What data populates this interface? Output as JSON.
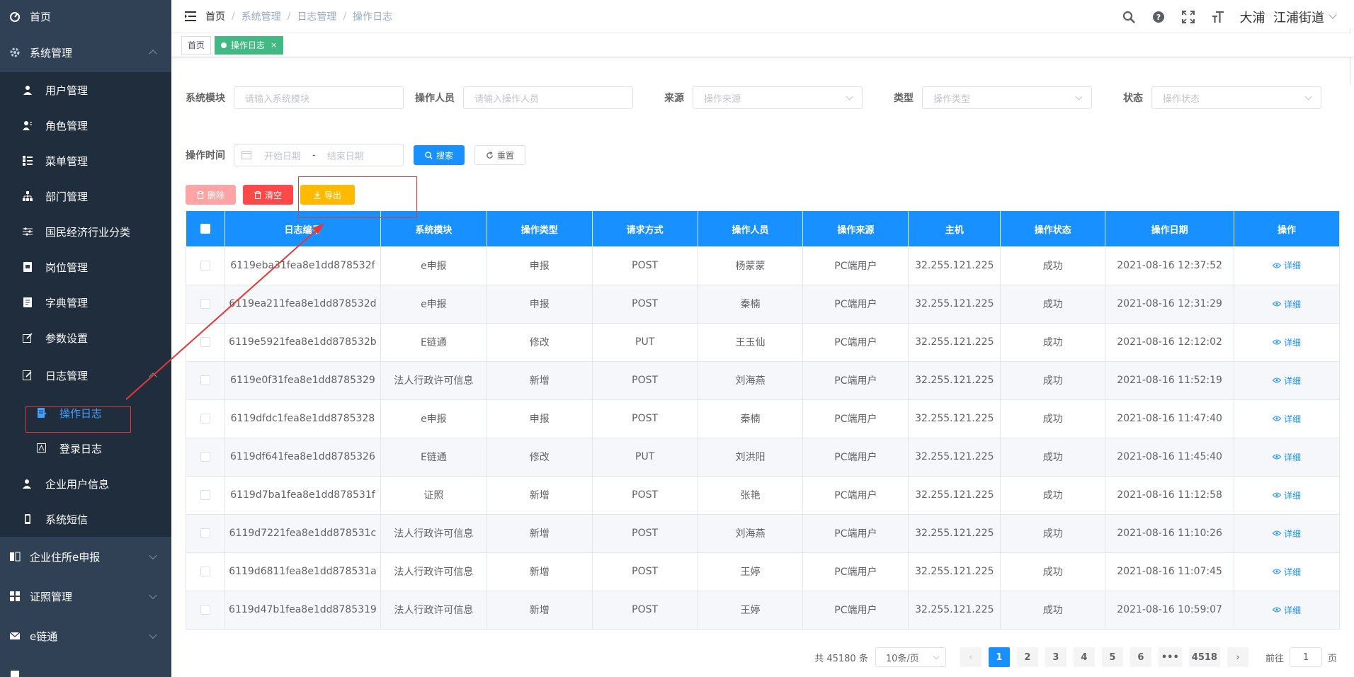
{
  "sidebar": {
    "items": [
      {
        "label": "首页",
        "icon": "dashboard-icon"
      },
      {
        "label": "系统管理",
        "icon": "gear-icon",
        "expanded": true
      },
      {
        "label": "企业住所e申报",
        "icon": "book-icon"
      },
      {
        "label": "证照管理",
        "icon": "grid-icon"
      },
      {
        "label": "e链通",
        "icon": "mail-icon"
      },
      {
        "label": "...",
        "icon": "doc-icon"
      }
    ],
    "system": [
      {
        "label": "用户管理"
      },
      {
        "label": "角色管理"
      },
      {
        "label": "菜单管理"
      },
      {
        "label": "部门管理"
      },
      {
        "label": "国民经济行业分类"
      },
      {
        "label": "岗位管理"
      },
      {
        "label": "字典管理"
      },
      {
        "label": "参数设置"
      },
      {
        "label": "日志管理"
      },
      {
        "label": "企业用户信息"
      },
      {
        "label": "系统短信"
      }
    ],
    "log": [
      {
        "label": "操作日志",
        "active": true
      },
      {
        "label": "登录日志"
      }
    ]
  },
  "navbar": {
    "breadcrumb": [
      "首页",
      "系统管理",
      "日志管理",
      "操作日志"
    ],
    "user": "大浦",
    "area": "江浦街道"
  },
  "tags": {
    "home": "首页",
    "current": "操作日志",
    "close": "×"
  },
  "filters": {
    "module_label": "系统模块",
    "module_placeholder": "请输入系统模块",
    "operator_label": "操作人员",
    "operator_placeholder": "请输入操作人员",
    "source_label": "来源",
    "source_placeholder": "操作来源",
    "type_label": "类型",
    "type_placeholder": "操作类型",
    "status_label": "状态",
    "status_placeholder": "操作状态",
    "time_label": "操作时间",
    "start_placeholder": "开始日期",
    "range_sep": "-",
    "end_placeholder": "结束日期",
    "search": "搜索",
    "reset": "重置"
  },
  "toolbar": {
    "delete": "删除",
    "clear": "清空",
    "export": "导出"
  },
  "table": {
    "headers": [
      "日志编号",
      "系统模块",
      "操作类型",
      "请求方式",
      "操作人员",
      "操作来源",
      "主机",
      "操作状态",
      "操作日期",
      "操作"
    ],
    "detail_label": "详细",
    "rows": [
      [
        "6119eba31fea8e1dd878532f",
        "e申报",
        "申报",
        "POST",
        "杨蒙蒙",
        "PC端用户",
        "32.255.121.225",
        "成功",
        "2021-08-16 12:37:52"
      ],
      [
        "6119ea211fea8e1dd878532d",
        "e申报",
        "申报",
        "POST",
        "秦楠",
        "PC端用户",
        "32.255.121.225",
        "成功",
        "2021-08-16 12:31:29"
      ],
      [
        "6119e5921fea8e1dd878532b",
        "E链通",
        "修改",
        "PUT",
        "王玉仙",
        "PC端用户",
        "32.255.121.225",
        "成功",
        "2021-08-16 12:12:02"
      ],
      [
        "6119e0f31fea8e1dd8785329",
        "法人行政许可信息",
        "新增",
        "POST",
        "刘海燕",
        "PC端用户",
        "32.255.121.225",
        "成功",
        "2021-08-16 11:52:19"
      ],
      [
        "6119dfdc1fea8e1dd8785328",
        "e申报",
        "申报",
        "POST",
        "秦楠",
        "PC端用户",
        "32.255.121.225",
        "成功",
        "2021-08-16 11:47:40"
      ],
      [
        "6119df641fea8e1dd8785326",
        "E链通",
        "修改",
        "PUT",
        "刘洪阳",
        "PC端用户",
        "32.255.121.225",
        "成功",
        "2021-08-16 11:45:40"
      ],
      [
        "6119d7ba1fea8e1dd878531f",
        "证照",
        "新增",
        "POST",
        "张艳",
        "PC端用户",
        "32.255.121.225",
        "成功",
        "2021-08-16 11:12:58"
      ],
      [
        "6119d7221fea8e1dd878531c",
        "法人行政许可信息",
        "新增",
        "POST",
        "刘海燕",
        "PC端用户",
        "32.255.121.225",
        "成功",
        "2021-08-16 11:10:26"
      ],
      [
        "6119d6811fea8e1dd878531a",
        "法人行政许可信息",
        "新增",
        "POST",
        "王婷",
        "PC端用户",
        "32.255.121.225",
        "成功",
        "2021-08-16 11:07:45"
      ],
      [
        "6119d47b1fea8e1dd8785319",
        "法人行政许可信息",
        "新增",
        "POST",
        "王婷",
        "PC端用户",
        "32.255.121.225",
        "成功",
        "2021-08-16 10:59:07"
      ]
    ]
  },
  "pagination": {
    "total": "共 45180 条",
    "page_size": "10条/页",
    "pages": [
      "1",
      "2",
      "3",
      "4",
      "5",
      "6",
      "•••",
      "4518"
    ],
    "prev": "‹",
    "next": "›",
    "goto_prefix": "前往",
    "goto_value": "1",
    "goto_suffix": "页"
  },
  "colors": {
    "primary": "#1890ff",
    "sidebar": "#304156",
    "annotation": "#e53935"
  }
}
